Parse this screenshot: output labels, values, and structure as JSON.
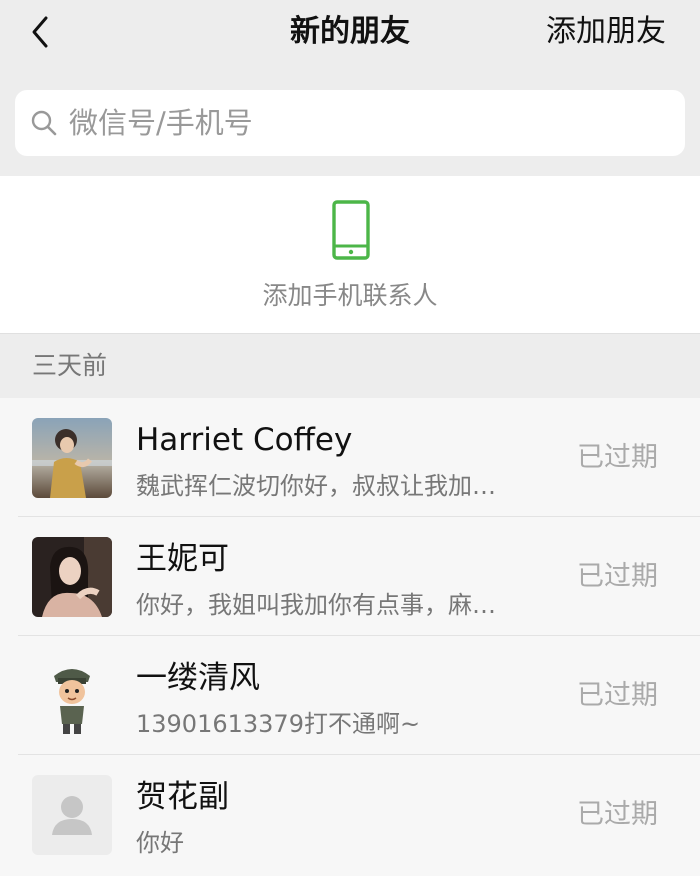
{
  "nav": {
    "title": "新的朋友",
    "action": "添加朋友"
  },
  "search": {
    "placeholder": "微信号/手机号"
  },
  "add_contacts": {
    "label": "添加手机联系人",
    "icon_color": "#4cb648"
  },
  "section": {
    "title": "三天前"
  },
  "requests": [
    {
      "name": "Harriet Coffey",
      "message": "魏武挥仁波切你好，叔叔让我加…",
      "status": "已过期",
      "avatar": "photo-avatar"
    },
    {
      "name": "王妮可",
      "message": "你好，我姐叫我加你有点事，麻…",
      "status": "已过期",
      "avatar": "photo-avatar"
    },
    {
      "name": "一缕清风",
      "message": "13901613379打不通啊~",
      "status": "已过期",
      "avatar": "cartoon-avatar"
    },
    {
      "name": "贺花副",
      "message": "你好",
      "status": "已过期",
      "avatar": "default-avatar"
    }
  ]
}
